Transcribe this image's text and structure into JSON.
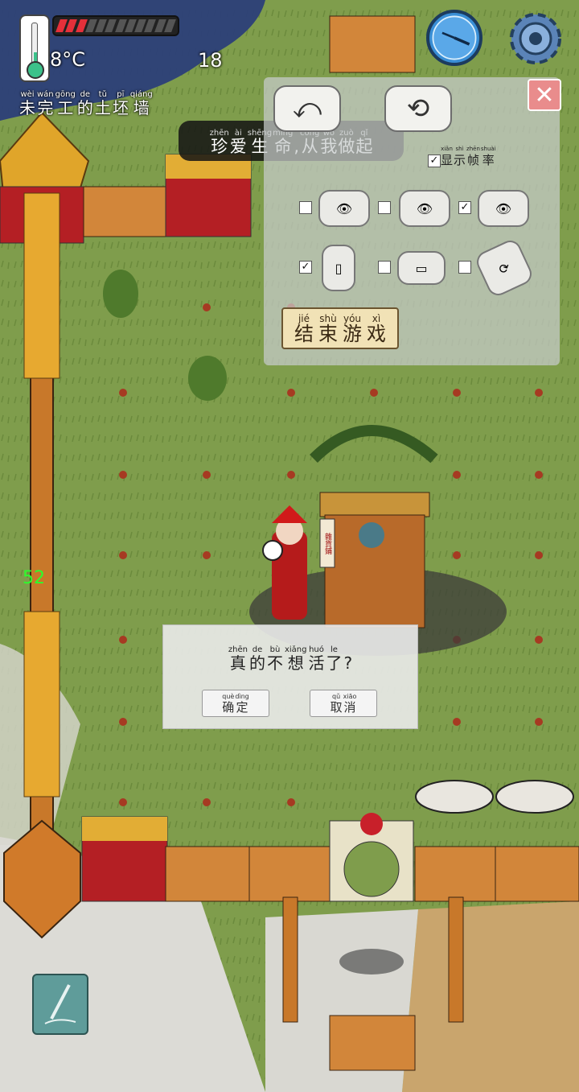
{
  "hud": {
    "temperature": "8°C",
    "day_count": "18",
    "health_segments_total": 12,
    "health_segments_filled": 3,
    "location": [
      {
        "py": "wèi",
        "hz": "未"
      },
      {
        "py": "wán",
        "hz": "完"
      },
      {
        "py": "gōng",
        "hz": "工"
      },
      {
        "py": "de",
        "hz": "的"
      },
      {
        "py": "tǔ",
        "hz": "土"
      },
      {
        "py": "pī",
        "hz": "坯"
      },
      {
        "py": "qiáng",
        "hz": "墙"
      }
    ],
    "fps": "52",
    "compass_icon": "compass-icon",
    "settings_icon": "gear-icon"
  },
  "tip": [
    {
      "py": "zhēn",
      "hz": "珍"
    },
    {
      "py": "ài",
      "hz": "爱"
    },
    {
      "py": "shēng",
      "hz": "生"
    },
    {
      "py": "mìng",
      "hz": "命"
    },
    {
      "py": "",
      "hz": ","
    },
    {
      "py": "cóng",
      "hz": "从"
    },
    {
      "py": "wǒ",
      "hz": "我"
    },
    {
      "py": "zuò",
      "hz": "做"
    },
    {
      "py": "qǐ",
      "hz": "起"
    }
  ],
  "settings_panel": {
    "undo_icon": "undo-icon",
    "refresh_icon": "refresh-icon",
    "close_icon": "close-icon",
    "show_fps": [
      {
        "py": "xiǎn",
        "hz": "显"
      },
      {
        "py": "shì",
        "hz": "示"
      },
      {
        "py": "zhēn",
        "hz": "帧"
      },
      {
        "py": "shuài",
        "hz": "率"
      }
    ],
    "show_fps_checked": true,
    "view_options": [
      {
        "icon": "eye-person-icon",
        "checked": false
      },
      {
        "icon": "eye-person-icon",
        "checked": false
      },
      {
        "icon": "eye-person-icon",
        "checked": true
      }
    ],
    "device_options": [
      {
        "icon": "phone-portrait-icon",
        "checked": true
      },
      {
        "icon": "phone-landscape-icon",
        "checked": false
      },
      {
        "icon": "phone-rotate-icon",
        "checked": false
      }
    ],
    "end_game": [
      {
        "py": "jié",
        "hz": "结"
      },
      {
        "py": "shù",
        "hz": "束"
      },
      {
        "py": "yóu",
        "hz": "游"
      },
      {
        "py": "xì",
        "hz": "戏"
      }
    ]
  },
  "dialog": {
    "question": [
      {
        "py": "zhēn",
        "hz": "真"
      },
      {
        "py": "de",
        "hz": "的"
      },
      {
        "py": "bù",
        "hz": "不"
      },
      {
        "py": "xiǎng",
        "hz": "想"
      },
      {
        "py": "huó",
        "hz": "活"
      },
      {
        "py": "le",
        "hz": "了"
      },
      {
        "py": "",
        "hz": "?"
      }
    ],
    "confirm": [
      {
        "py": "què",
        "hz": "确"
      },
      {
        "py": "dìng",
        "hz": "定"
      }
    ],
    "cancel": [
      {
        "py": "qǔ",
        "hz": "取"
      },
      {
        "py": "xiāo",
        "hz": "消"
      }
    ]
  },
  "shop_sign": "雜貨鋪",
  "colors": {
    "grass": "#7c9a4a",
    "wall_red": "#b41f24",
    "roof_gold": "#e0a52a",
    "health_red": "#e5303a",
    "fps_green": "#2bff2b"
  }
}
